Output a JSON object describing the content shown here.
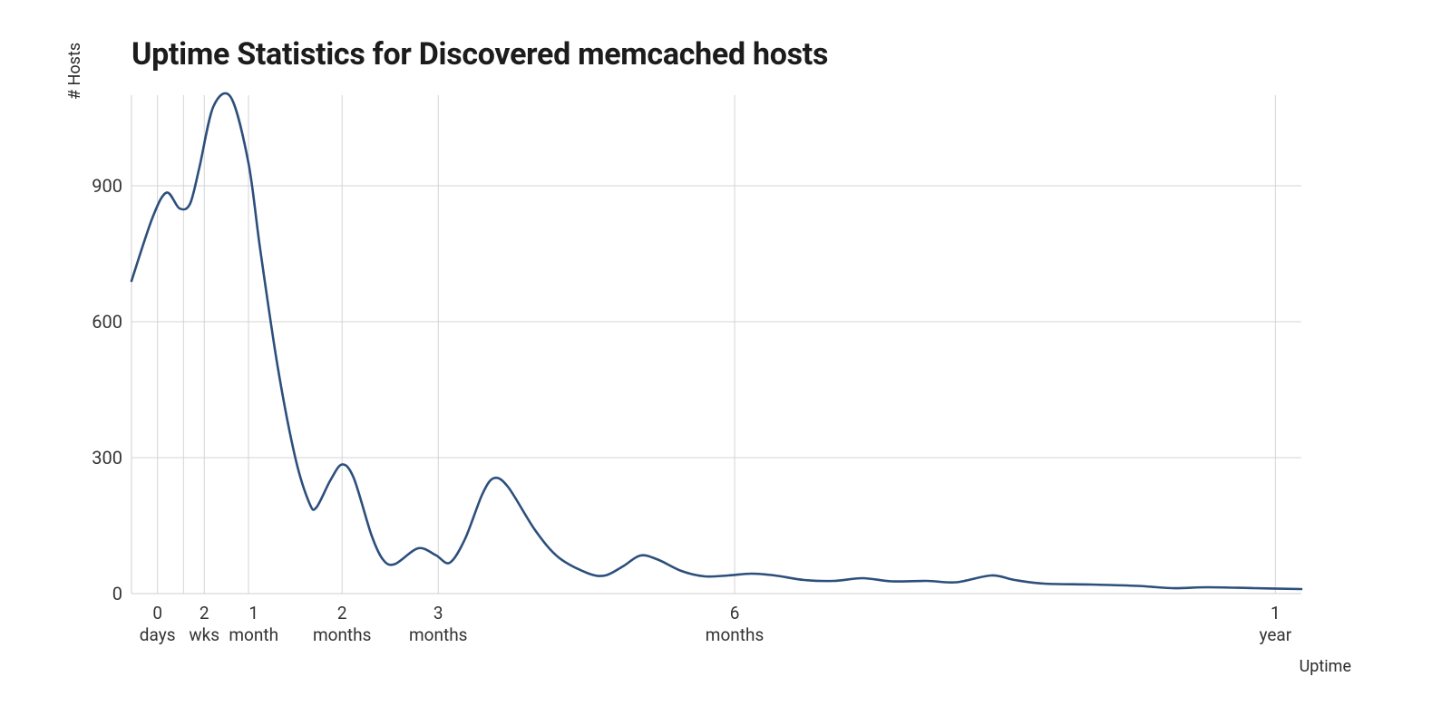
{
  "chart_data": {
    "type": "line",
    "title": "Uptime Statistics for Discovered memcached hosts",
    "xlabel": "Uptime",
    "ylabel": "# Hosts",
    "ylim": [
      0,
      1100
    ],
    "y_ticks": [
      0,
      300,
      600,
      900
    ],
    "x_ticks": [
      {
        "pos": 0.02222,
        "label": "0\ndays"
      },
      {
        "pos": 0.06222,
        "label": "2\nwks"
      },
      {
        "pos": 0.10444,
        "label": "1\nmonth"
      },
      {
        "pos": 0.18,
        "label": "2\nmonths"
      },
      {
        "pos": 0.26222,
        "label": "3\nmonths"
      },
      {
        "pos": 0.51555,
        "label": "6\nmonths"
      },
      {
        "pos": 0.97777,
        "label": "1\nyear"
      }
    ],
    "x_gridlines": [
      0.02222,
      0.04444,
      0.06222,
      0.1,
      0.18,
      0.26222,
      0.51555,
      0.97777
    ],
    "series": [
      {
        "name": "hosts",
        "color": "#2d4f7c",
        "points": [
          {
            "x": 0.0,
            "y": 690
          },
          {
            "x": 0.018,
            "y": 830
          },
          {
            "x": 0.03,
            "y": 885
          },
          {
            "x": 0.041,
            "y": 850
          },
          {
            "x": 0.05,
            "y": 860
          },
          {
            "x": 0.058,
            "y": 940
          },
          {
            "x": 0.07,
            "y": 1075
          },
          {
            "x": 0.085,
            "y": 1095
          },
          {
            "x": 0.1,
            "y": 950
          },
          {
            "x": 0.11,
            "y": 760
          },
          {
            "x": 0.125,
            "y": 500
          },
          {
            "x": 0.14,
            "y": 300
          },
          {
            "x": 0.152,
            "y": 200
          },
          {
            "x": 0.158,
            "y": 190
          },
          {
            "x": 0.17,
            "y": 250
          },
          {
            "x": 0.18,
            "y": 285
          },
          {
            "x": 0.19,
            "y": 255
          },
          {
            "x": 0.205,
            "y": 130
          },
          {
            "x": 0.215,
            "y": 75
          },
          {
            "x": 0.225,
            "y": 65
          },
          {
            "x": 0.245,
            "y": 100
          },
          {
            "x": 0.26,
            "y": 85
          },
          {
            "x": 0.272,
            "y": 68
          },
          {
            "x": 0.285,
            "y": 120
          },
          {
            "x": 0.3,
            "y": 220
          },
          {
            "x": 0.31,
            "y": 255
          },
          {
            "x": 0.322,
            "y": 235
          },
          {
            "x": 0.345,
            "y": 140
          },
          {
            "x": 0.365,
            "y": 80
          },
          {
            "x": 0.39,
            "y": 45
          },
          {
            "x": 0.405,
            "y": 40
          },
          {
            "x": 0.42,
            "y": 60
          },
          {
            "x": 0.435,
            "y": 84
          },
          {
            "x": 0.45,
            "y": 75
          },
          {
            "x": 0.47,
            "y": 50
          },
          {
            "x": 0.49,
            "y": 38
          },
          {
            "x": 0.51,
            "y": 40
          },
          {
            "x": 0.53,
            "y": 44
          },
          {
            "x": 0.55,
            "y": 40
          },
          {
            "x": 0.575,
            "y": 30
          },
          {
            "x": 0.6,
            "y": 28
          },
          {
            "x": 0.625,
            "y": 34
          },
          {
            "x": 0.65,
            "y": 27
          },
          {
            "x": 0.68,
            "y": 28
          },
          {
            "x": 0.705,
            "y": 25
          },
          {
            "x": 0.735,
            "y": 40
          },
          {
            "x": 0.755,
            "y": 30
          },
          {
            "x": 0.78,
            "y": 22
          },
          {
            "x": 0.82,
            "y": 20
          },
          {
            "x": 0.86,
            "y": 17
          },
          {
            "x": 0.89,
            "y": 12
          },
          {
            "x": 0.92,
            "y": 14
          },
          {
            "x": 0.96,
            "y": 12
          },
          {
            "x": 1.0,
            "y": 10
          }
        ]
      }
    ]
  }
}
